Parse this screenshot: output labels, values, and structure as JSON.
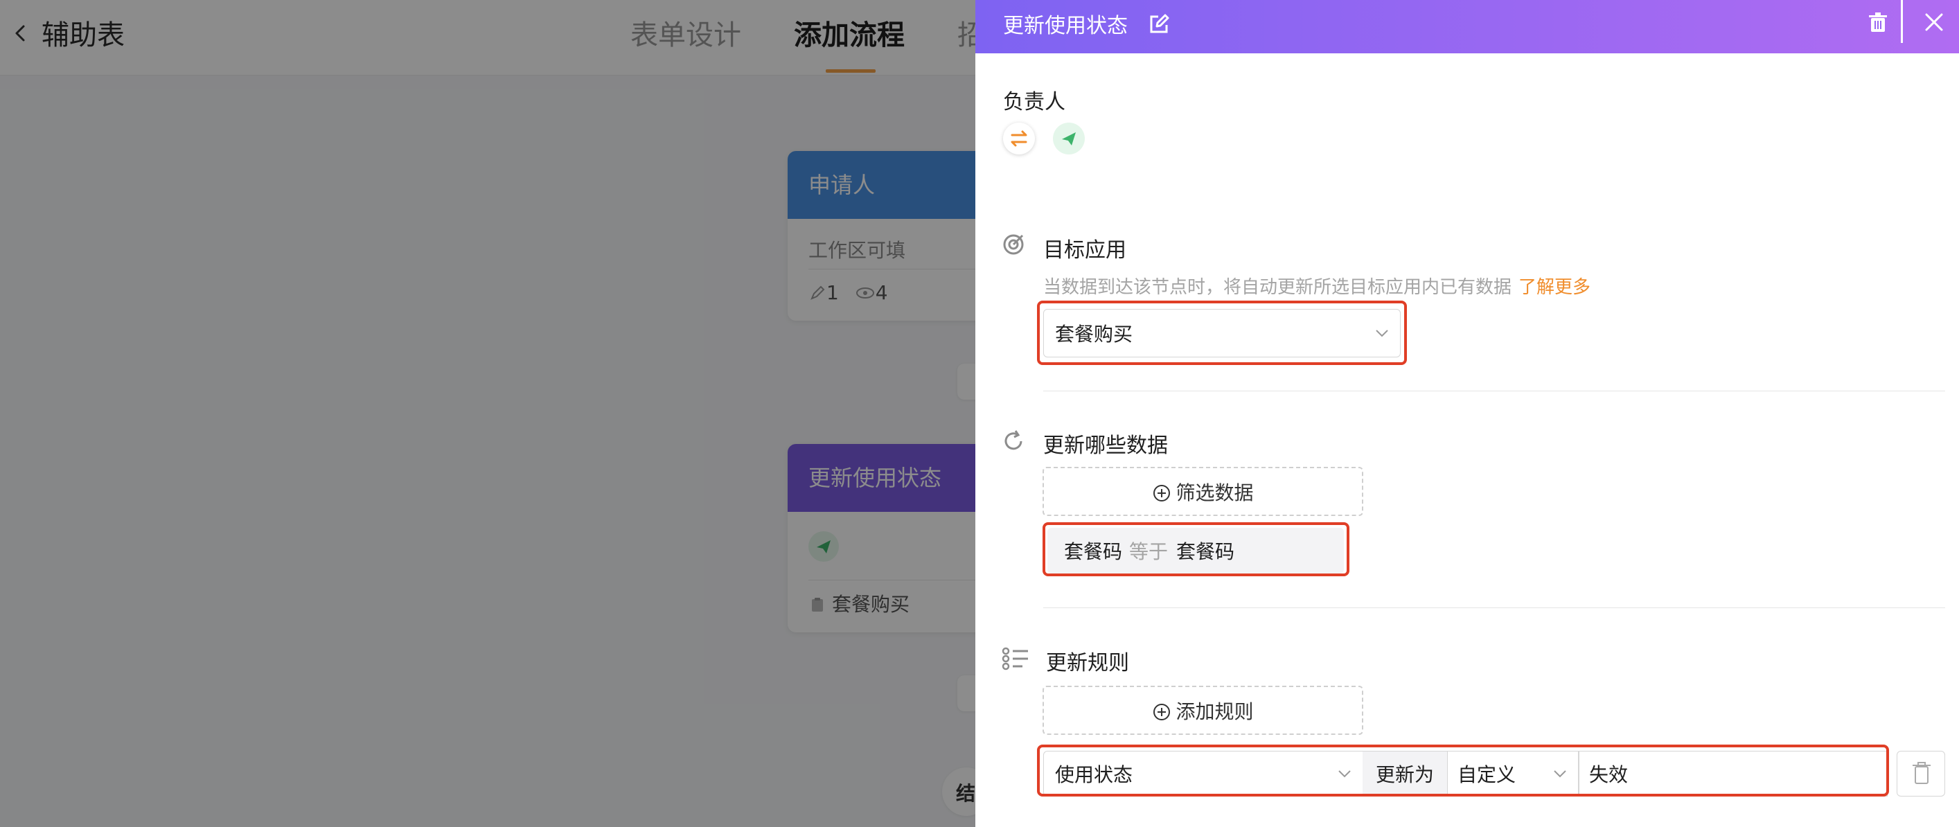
{
  "app": {
    "title": "辅助表",
    "tabs": [
      {
        "label": "表单设计",
        "active": false
      },
      {
        "label": "添加流程",
        "active": true
      },
      {
        "label": "招",
        "active": false
      }
    ]
  },
  "canvas": {
    "nodes": [
      {
        "title": "申请人",
        "subtitle": "工作区可填",
        "edit_count": "1",
        "view_count": "4"
      },
      {
        "title": "更新使用状态",
        "app_ref": "套餐购买"
      }
    ],
    "partial_text": "结"
  },
  "drawer": {
    "title": "更新使用状态",
    "owner_label": "负责人",
    "target_app": {
      "label": "目标应用",
      "hint": "当数据到达该节点时，将自动更新所选目标应用内已有数据",
      "learn_more": "了解更多",
      "selected": "套餐购买"
    },
    "update_data": {
      "label": "更新哪些数据",
      "filter_button": "筛选数据",
      "filter": {
        "field": "套餐码",
        "operator": "等于",
        "value": "套餐码"
      }
    },
    "update_rules": {
      "label": "更新规则",
      "add_button": "添加规则",
      "rule": {
        "field": "使用状态",
        "action": "更新为",
        "mode": "自定义",
        "value": "失效"
      }
    }
  },
  "colors": {
    "header_gradient_start": "#7e63f2",
    "header_gradient_end": "#b06cf2",
    "accent_orange": "#f08d2c",
    "highlight_red": "#e03e26",
    "node_blue": "#4a90e2",
    "node_purple": "#7a5be0"
  }
}
